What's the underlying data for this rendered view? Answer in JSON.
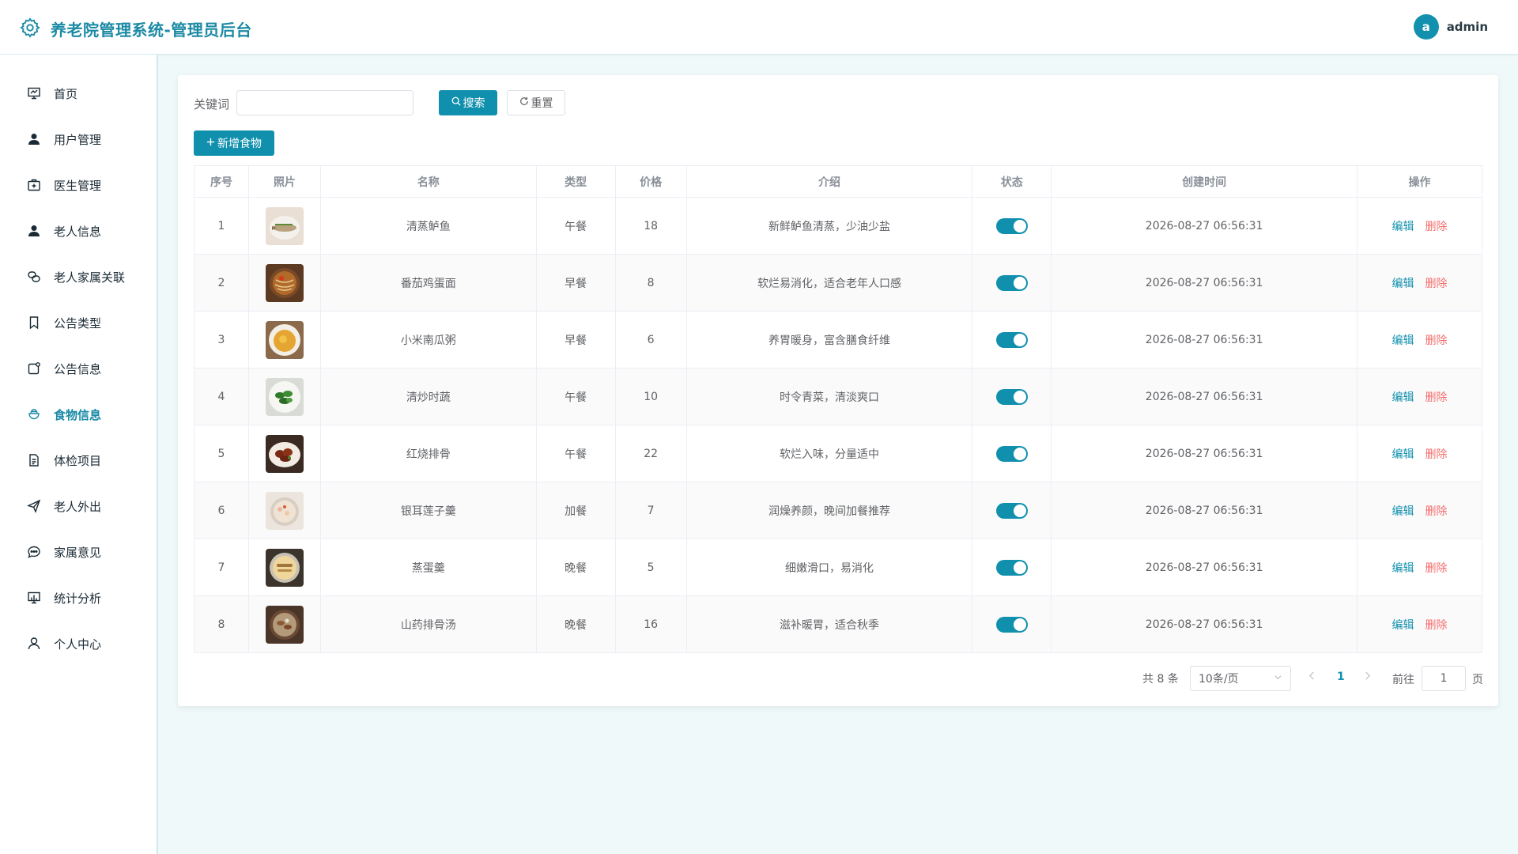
{
  "header": {
    "title": "养老院管理系统-管理员后台",
    "avatar_letter": "a",
    "username": "admin"
  },
  "sidebar": {
    "items": [
      {
        "label": "首页",
        "icon": "dashboard-icon"
      },
      {
        "label": "用户管理",
        "icon": "user-icon"
      },
      {
        "label": "医生管理",
        "icon": "medical-kit-icon"
      },
      {
        "label": "老人信息",
        "icon": "person-icon"
      },
      {
        "label": "老人家属关联",
        "icon": "link-icon"
      },
      {
        "label": "公告类型",
        "icon": "bookmark-icon"
      },
      {
        "label": "公告信息",
        "icon": "notice-icon"
      },
      {
        "label": "食物信息",
        "icon": "food-icon",
        "active": true
      },
      {
        "label": "体检项目",
        "icon": "document-icon"
      },
      {
        "label": "老人外出",
        "icon": "send-icon"
      },
      {
        "label": "家属意见",
        "icon": "chat-icon"
      },
      {
        "label": "统计分析",
        "icon": "chart-icon"
      },
      {
        "label": "个人中心",
        "icon": "profile-icon"
      }
    ]
  },
  "toolbar": {
    "keyword_label": "关键词",
    "keyword_value": "",
    "search_label": "搜索",
    "reset_label": "重置",
    "add_label": "新增食物"
  },
  "table": {
    "headers": [
      "序号",
      "照片",
      "名称",
      "类型",
      "价格",
      "介绍",
      "状态",
      "创建时间",
      "操作"
    ],
    "edit_label": "编辑",
    "delete_label": "删除",
    "rows": [
      {
        "no": "1",
        "name": "清蒸鲈鱼",
        "type": "午餐",
        "price": "18",
        "desc": "新鲜鲈鱼清蒸，少油少盐",
        "status": true,
        "created": "2026-08-27 06:56:31",
        "photo": "fish"
      },
      {
        "no": "2",
        "name": "番茄鸡蛋面",
        "type": "早餐",
        "price": "8",
        "desc": "软烂易消化，适合老年人口感",
        "status": true,
        "created": "2026-08-27 06:56:31",
        "photo": "noodles"
      },
      {
        "no": "3",
        "name": "小米南瓜粥",
        "type": "早餐",
        "price": "6",
        "desc": "养胃暖身，富含膳食纤维",
        "status": true,
        "created": "2026-08-27 06:56:31",
        "photo": "porridge"
      },
      {
        "no": "4",
        "name": "清炒时蔬",
        "type": "午餐",
        "price": "10",
        "desc": "时令青菜，清淡爽口",
        "status": true,
        "created": "2026-08-27 06:56:31",
        "photo": "greens"
      },
      {
        "no": "5",
        "name": "红烧排骨",
        "type": "午餐",
        "price": "22",
        "desc": "软烂入味，分量适中",
        "status": true,
        "created": "2026-08-27 06:56:31",
        "photo": "ribs"
      },
      {
        "no": "6",
        "name": "银耳莲子羹",
        "type": "加餐",
        "price": "7",
        "desc": "润燥养颜，晚间加餐推荐",
        "status": true,
        "created": "2026-08-27 06:56:31",
        "photo": "soup-white"
      },
      {
        "no": "7",
        "name": "蒸蛋羹",
        "type": "晚餐",
        "price": "5",
        "desc": "细嫩滑口，易消化",
        "status": true,
        "created": "2026-08-27 06:56:31",
        "photo": "egg"
      },
      {
        "no": "8",
        "name": "山药排骨汤",
        "type": "晚餐",
        "price": "16",
        "desc": "滋补暖胃，适合秋季",
        "status": true,
        "created": "2026-08-27 06:56:31",
        "photo": "stew"
      }
    ]
  },
  "pagination": {
    "total_text": "共 8 条",
    "page_size": "10条/页",
    "current_page": "1",
    "goto_label": "前往",
    "goto_value": "1",
    "page_unit": "页"
  },
  "colors": {
    "primary": "#1190ae",
    "danger": "#f56c6c",
    "brand_text": "#1b8aa4"
  }
}
